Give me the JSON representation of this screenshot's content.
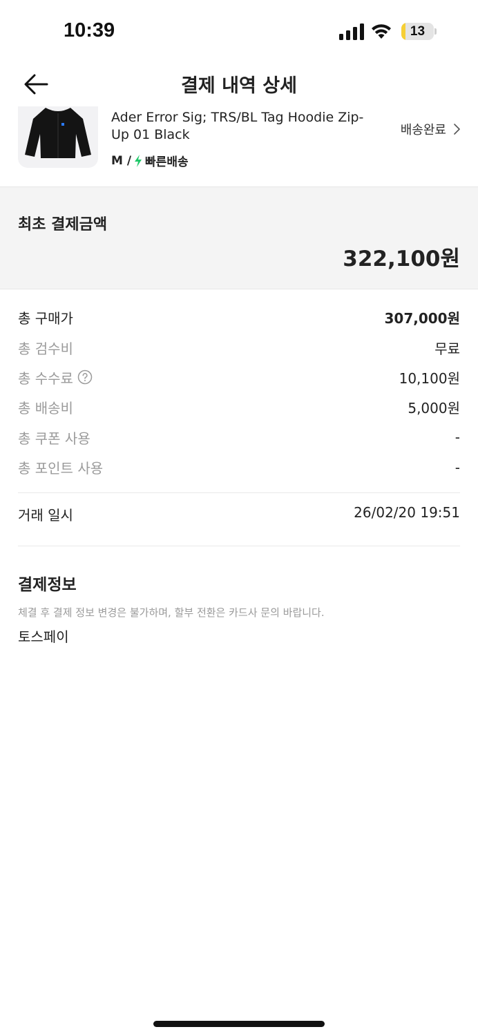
{
  "status_bar": {
    "time": "10:39",
    "battery_level": "13",
    "icons": [
      "cellular-signal-icon",
      "wifi-icon",
      "battery-icon"
    ],
    "battery_color": "#f6cf35"
  },
  "header": {
    "title": "결제 내역 상세",
    "back_icon": "arrow-left-icon"
  },
  "product": {
    "name": "Ader Error Sig; TRS/BL Tag Hoodie Zip-Up 01 Black",
    "size": "M /",
    "shipping_type": "빠른배송",
    "shipping_icon": "lightning-bolt-icon",
    "shipping_icon_color": "#20c86a",
    "status": "배송완료"
  },
  "total": {
    "label": "최초 결제금액",
    "amount": "322,100원"
  },
  "breakdown": [
    {
      "label": "총 구매가",
      "value": "307,000원"
    },
    {
      "label": "총 검수비",
      "value": "무료"
    },
    {
      "label": "총 수수료",
      "value": "10,100원"
    },
    {
      "label": "총 배송비",
      "value": "5,000원"
    },
    {
      "label": "총 쿠폰 사용",
      "value": "-"
    },
    {
      "label": "총 포인트 사용",
      "value": "-"
    }
  ],
  "trade": {
    "label": "거래 일시",
    "value": "26/02/20 19:51"
  },
  "payment": {
    "title": "결제정보",
    "notice": "체결 후 결제 정보 변경은 불가하며, 할부 전환은 카드사 문의 바랍니다.",
    "method": "토스페이"
  }
}
